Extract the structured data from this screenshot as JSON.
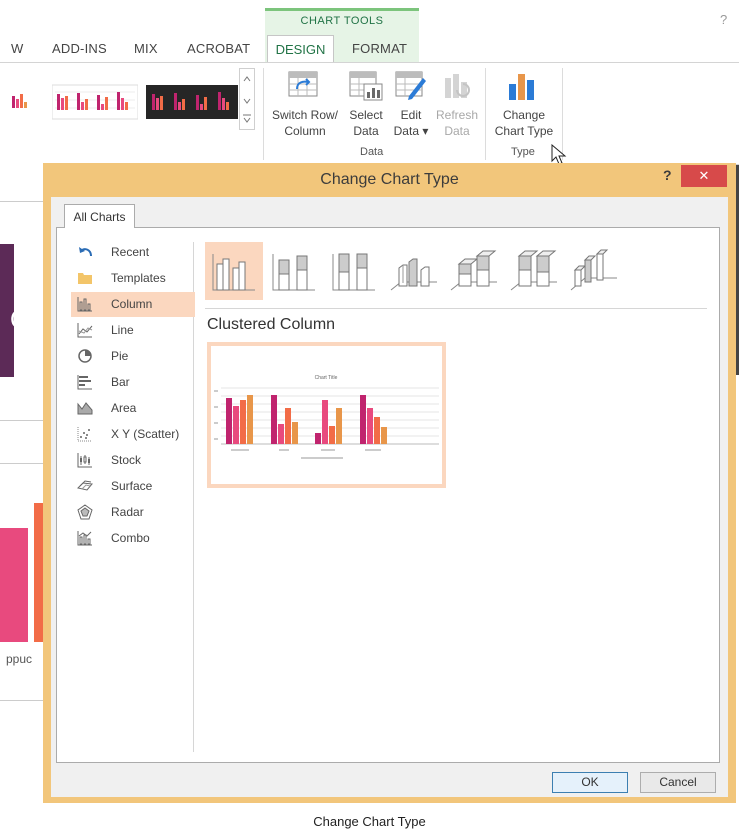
{
  "ribbon": {
    "tabs": [
      "W",
      "ADD-INS",
      "MIX",
      "ACROBAT"
    ],
    "chart_tools_label": "CHART TOOLS",
    "design_tab": "DESIGN",
    "format_tab": "FORMAT",
    "help": "?",
    "switch_row_col": [
      "Switch Row/",
      "Column"
    ],
    "select_data": [
      "Select",
      "Data"
    ],
    "edit_data": [
      "Edit",
      "Data ▾"
    ],
    "refresh_data": [
      "Refresh",
      "Data"
    ],
    "change_chart_type": [
      "Change",
      "Chart Type"
    ],
    "group_data": "Data",
    "group_type": "Type"
  },
  "dialog": {
    "title": "Change Chart Type",
    "help": "?",
    "close": "✕",
    "tab": "All Charts",
    "categories": [
      {
        "label": "Recent",
        "icon": "recent-icon"
      },
      {
        "label": "Templates",
        "icon": "templates-folder-icon"
      },
      {
        "label": "Column",
        "icon": "column-chart-icon"
      },
      {
        "label": "Line",
        "icon": "line-chart-icon"
      },
      {
        "label": "Pie",
        "icon": "pie-chart-icon"
      },
      {
        "label": "Bar",
        "icon": "bar-chart-icon"
      },
      {
        "label": "Area",
        "icon": "area-chart-icon"
      },
      {
        "label": "X Y (Scatter)",
        "icon": "scatter-chart-icon"
      },
      {
        "label": "Stock",
        "icon": "stock-chart-icon"
      },
      {
        "label": "Surface",
        "icon": "surface-chart-icon"
      },
      {
        "label": "Radar",
        "icon": "radar-chart-icon"
      },
      {
        "label": "Combo",
        "icon": "combo-chart-icon"
      }
    ],
    "selected_category": "Column",
    "subtype_icons": [
      "clustered-column-icon",
      "stacked-column-icon",
      "100-stacked-column-icon",
      "3d-clustered-column-icon",
      "3d-stacked-column-icon",
      "3d-100-stacked-column-icon",
      "3d-column-icon"
    ],
    "selected_subtype": "Clustered Column",
    "preview_title": "Chart Title",
    "ok": "OK",
    "cancel": "Cancel"
  },
  "background": {
    "partial_text": "ppuc"
  },
  "caption": "Change Chart Type",
  "colors": {
    "selection": "#fbd7bf",
    "dialog_border": "#f2c67b",
    "close_button": "#d74a4a",
    "series": [
      "#c0246e",
      "#e84a7e",
      "#f26c47",
      "#e8964a"
    ]
  }
}
